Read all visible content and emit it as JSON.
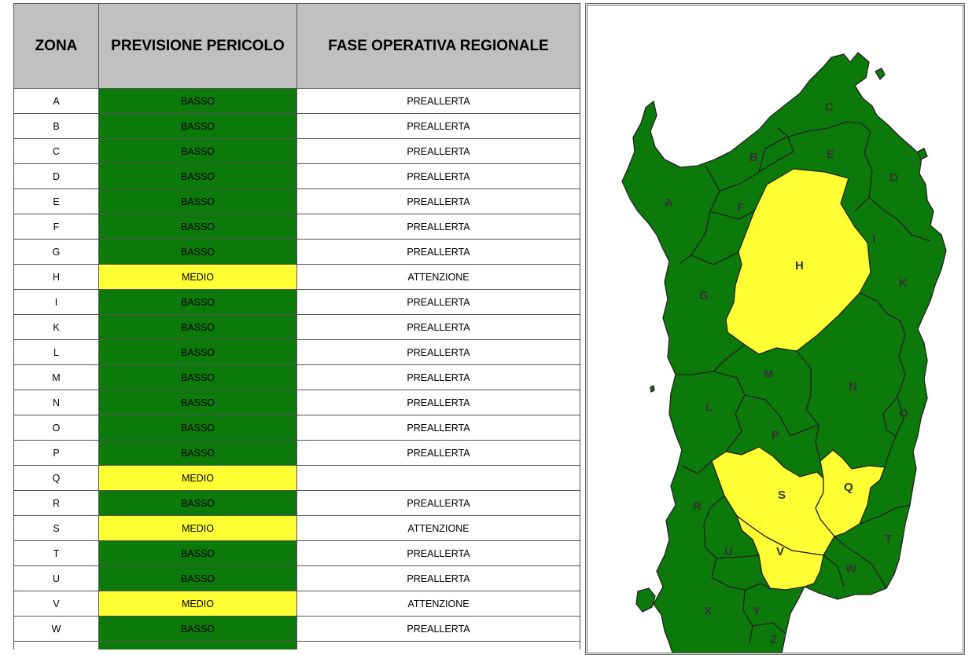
{
  "table": {
    "headers": {
      "zona": "ZONA",
      "previsione": "PREVISIONE PERICOLO",
      "fase": "FASE OPERATIVA REGIONALE"
    },
    "rows": [
      {
        "zona": "A",
        "previsione": "BASSO",
        "fase": "PREALLERTA",
        "level": "basso"
      },
      {
        "zona": "B",
        "previsione": "BASSO",
        "fase": "PREALLERTA",
        "level": "basso"
      },
      {
        "zona": "C",
        "previsione": "BASSO",
        "fase": "PREALLERTA",
        "level": "basso"
      },
      {
        "zona": "D",
        "previsione": "BASSO",
        "fase": "PREALLERTA",
        "level": "basso"
      },
      {
        "zona": "E",
        "previsione": "BASSO",
        "fase": "PREALLERTA",
        "level": "basso"
      },
      {
        "zona": "F",
        "previsione": "BASSO",
        "fase": "PREALLERTA",
        "level": "basso"
      },
      {
        "zona": "G",
        "previsione": "BASSO",
        "fase": "PREALLERTA",
        "level": "basso"
      },
      {
        "zona": "H",
        "previsione": "MEDIO",
        "fase": "ATTENZIONE",
        "level": "medio"
      },
      {
        "zona": "I",
        "previsione": "BASSO",
        "fase": "PREALLERTA",
        "level": "basso"
      },
      {
        "zona": "K",
        "previsione": "BASSO",
        "fase": "PREALLERTA",
        "level": "basso"
      },
      {
        "zona": "L",
        "previsione": "BASSO",
        "fase": "PREALLERTA",
        "level": "basso"
      },
      {
        "zona": "M",
        "previsione": "BASSO",
        "fase": "PREALLERTA",
        "level": "basso"
      },
      {
        "zona": "N",
        "previsione": "BASSO",
        "fase": "PREALLERTA",
        "level": "basso"
      },
      {
        "zona": "O",
        "previsione": "BASSO",
        "fase": "PREALLERTA",
        "level": "basso"
      },
      {
        "zona": "P",
        "previsione": "BASSO",
        "fase": "PREALLERTA",
        "level": "basso"
      },
      {
        "zona": "Q",
        "previsione": "MEDIO",
        "fase": "",
        "level": "medio"
      },
      {
        "zona": "R",
        "previsione": "BASSO",
        "fase": "PREALLERTA",
        "level": "basso"
      },
      {
        "zona": "S",
        "previsione": "MEDIO",
        "fase": "ATTENZIONE",
        "level": "medio"
      },
      {
        "zona": "T",
        "previsione": "BASSO",
        "fase": "PREALLERTA",
        "level": "basso"
      },
      {
        "zona": "U",
        "previsione": "BASSO",
        "fase": "PREALLERTA",
        "level": "basso"
      },
      {
        "zona": "V",
        "previsione": "MEDIO",
        "fase": "ATTENZIONE",
        "level": "medio"
      },
      {
        "zona": "W",
        "previsione": "BASSO",
        "fase": "PREALLERTA",
        "level": "basso"
      },
      {
        "zona": "",
        "previsione": "",
        "fase": "",
        "level": "basso"
      }
    ]
  },
  "map": {
    "labels": [
      "A",
      "B",
      "C",
      "D",
      "E",
      "F",
      "G",
      "H",
      "I",
      "K",
      "L",
      "M",
      "N",
      "O",
      "P",
      "Q",
      "R",
      "S",
      "T",
      "U",
      "V",
      "W",
      "X",
      "Y",
      "Z"
    ]
  },
  "colors": {
    "basso": "#0b7a0b",
    "medio": "#ffff33",
    "header_bg": "#c0c0c0"
  }
}
